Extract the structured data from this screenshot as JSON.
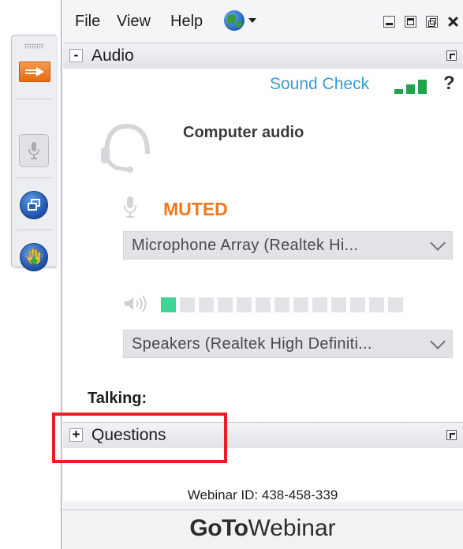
{
  "menubar": {
    "file": "File",
    "view": "View",
    "help": "Help",
    "language_icon": "globe-icon"
  },
  "window_controls": [
    "minimize",
    "maximize",
    "restore",
    "close"
  ],
  "toolbar": {
    "buttons": [
      {
        "name": "show-hide-panel",
        "icon": "orange-arrow-icon"
      },
      {
        "name": "microphone",
        "icon": "microphone-icon",
        "state": "disabled"
      },
      {
        "name": "screen-viewer",
        "icon": "screen-viewer-icon"
      },
      {
        "name": "raise-hand",
        "icon": "raise-hand-icon"
      }
    ]
  },
  "audio": {
    "title": "Audio",
    "toggle": "-",
    "sound_check": "Sound Check",
    "help": "?",
    "mode_label": "Computer audio",
    "mic_status": "MUTED",
    "microphone_device": "Microphone Array (Realtek Hi...",
    "speaker_device": "Speakers (Realtek High Definiti...",
    "speaker_level": {
      "active_segments": 1,
      "total_segments": 13
    },
    "talking_label": "Talking:"
  },
  "questions": {
    "title": "Questions",
    "toggle": "+"
  },
  "footer": {
    "webinar_id": "Webinar ID: 438-458-339",
    "brand_bold": "GoTo",
    "brand_rest": "Webinar"
  },
  "colors": {
    "accent_orange": "#f0781f",
    "link_blue": "#3c9ad2",
    "signal_green": "#22a24b",
    "level_green": "#3ed494",
    "highlight_red": "#ec1c24"
  }
}
